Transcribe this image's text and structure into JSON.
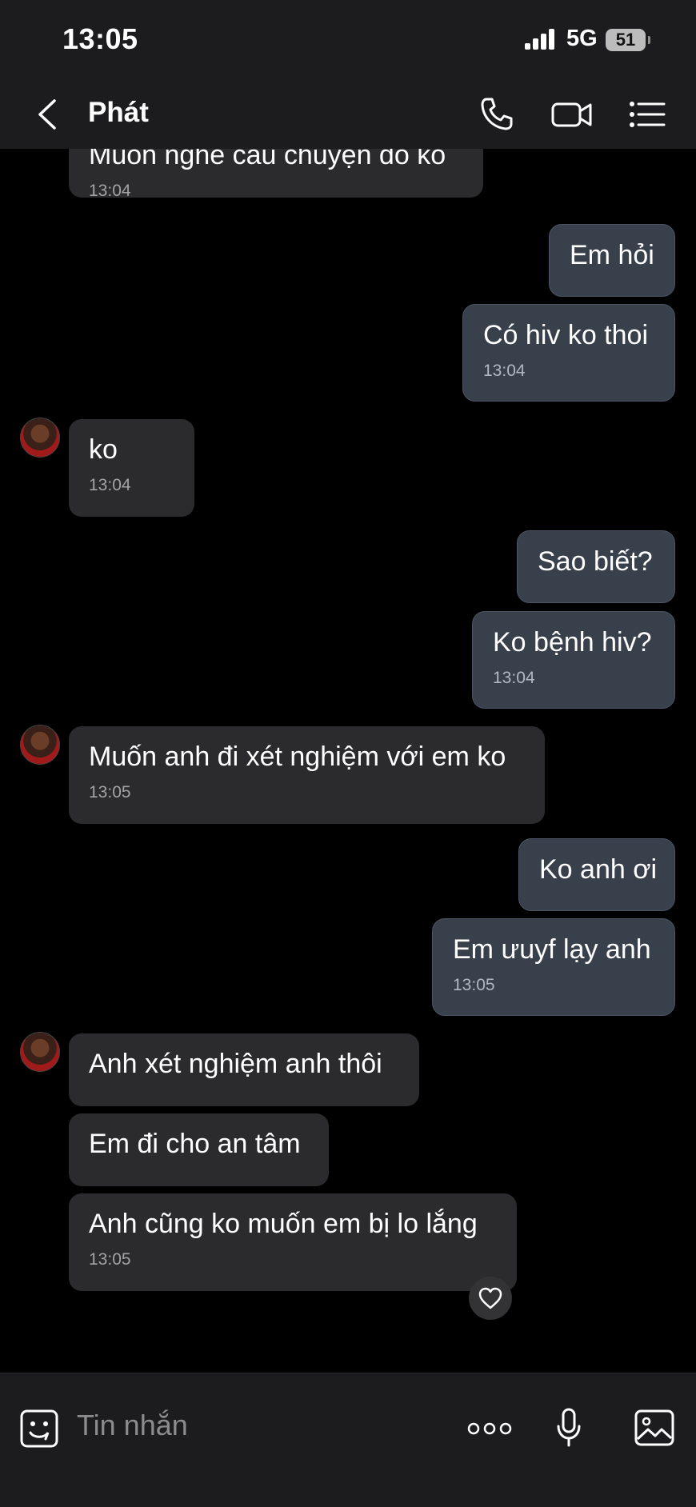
{
  "status": {
    "time": "13:05",
    "network": "5G",
    "battery": "51"
  },
  "header": {
    "contact_name": "Phát"
  },
  "messages": [
    {
      "side": "in",
      "text": "Muốn nghe câu chuyện đó ko",
      "time": "13:04"
    },
    {
      "side": "out",
      "text": "Em hỏi"
    },
    {
      "side": "out",
      "text": "Có hiv ko thoi",
      "time": "13:04"
    },
    {
      "side": "in",
      "text": "ko",
      "time": "13:04"
    },
    {
      "side": "out",
      "text": "Sao biết?"
    },
    {
      "side": "out",
      "text": "Ko bệnh hiv?",
      "time": "13:04"
    },
    {
      "side": "in",
      "text": "Muốn anh đi xét nghiệm với em ko",
      "time": "13:05"
    },
    {
      "side": "out",
      "text": "Ko anh ơi"
    },
    {
      "side": "out",
      "text": "Em ưuyf lạy anh",
      "time": "13:05"
    },
    {
      "side": "in",
      "text": "Anh xét nghiệm anh thôi"
    },
    {
      "side": "in",
      "text": "Em đi cho an tâm"
    },
    {
      "side": "in",
      "text": "Anh cũng ko muốn em bị lo lắng",
      "time": "13:05"
    }
  ],
  "input": {
    "placeholder": "Tin nhắn"
  },
  "icons": {
    "back": "chevron-left-icon",
    "call": "phone-icon",
    "video": "video-camera-icon",
    "menu": "list-menu-icon",
    "emoji": "sticker-face-icon",
    "more": "more-dots-icon",
    "mic": "microphone-icon",
    "image": "image-icon",
    "reaction": "heart-icon"
  },
  "colors": {
    "background": "#000000",
    "bar": "#1c1c1e",
    "incoming": "#2b2b2d",
    "outgoing": "#38404c"
  }
}
